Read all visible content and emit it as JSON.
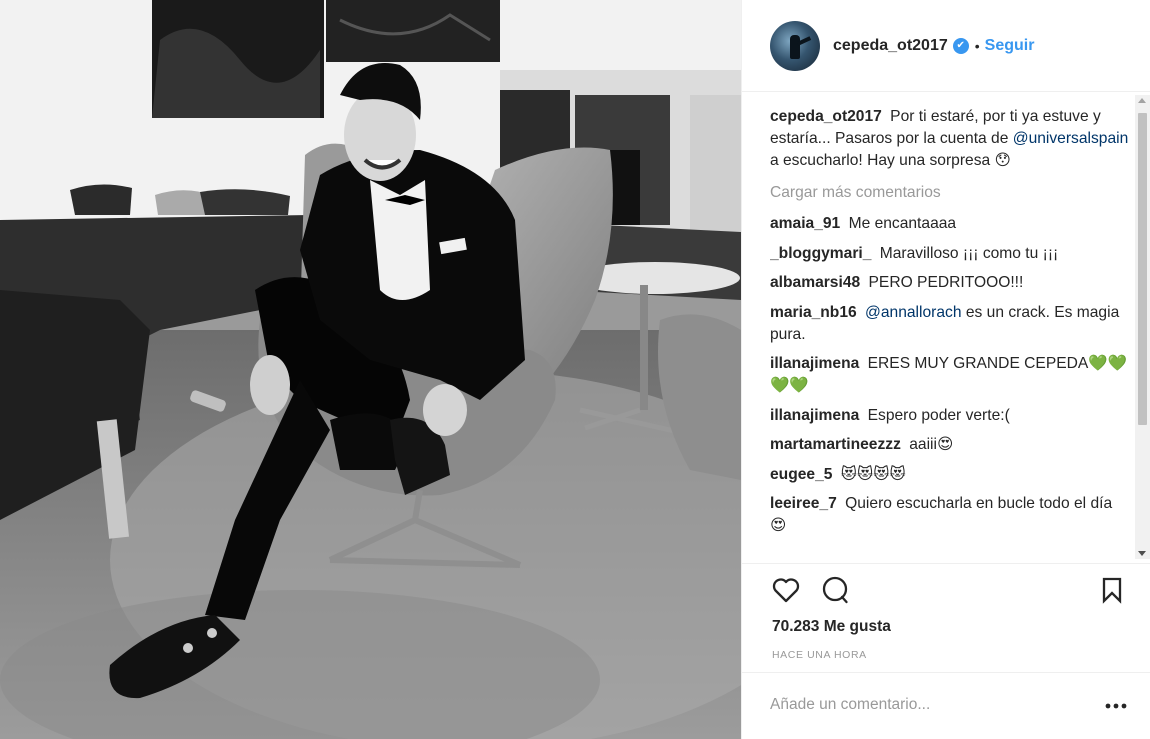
{
  "post": {
    "username": "cepeda_ot2017",
    "verified_mark": "✔",
    "separator": "•",
    "follow_label": "Seguir",
    "caption": {
      "username": "cepeda_ot2017",
      "text_before": "Por ti estaré, por ti ya estuve y estaría... Pasaros por la cuenta de",
      "mention": "@universalspain",
      "text_after": "a escucharlo! Hay una sorpresa",
      "emoji": "😯"
    },
    "load_more_label": "Cargar más comentarios",
    "comments": [
      {
        "username": "amaia_91",
        "text": "Me encantaaaa"
      },
      {
        "username": "_bloggymari_",
        "text": "Maravilloso ¡¡¡ como tu ¡¡¡"
      },
      {
        "username": "albamarsi48",
        "text": "PERO PEDRITOOO!!!"
      },
      {
        "username": "maria_nb16",
        "mention": "@annallorach",
        "text": "es un crack. Es magia pura."
      },
      {
        "username": "illanajimena",
        "text": "ERES MUY GRANDE CEPEDA",
        "emoji": "💚💚💚💚"
      },
      {
        "username": "illanajimena",
        "text": "Espero poder verte:("
      },
      {
        "username": "martamartineezzz",
        "text": "aaiii",
        "emoji": "😍"
      },
      {
        "username": "eugee_5",
        "text": "",
        "emoji": "😻😻😻😻"
      },
      {
        "username": "leeiree_7",
        "text": "Quiero escucharla en bucle todo el día",
        "emoji": "😍"
      }
    ],
    "likes_label": "70.283 Me gusta",
    "time_label": "HACE UNA HORA",
    "add_comment_placeholder": "Añade un comentario...",
    "colors": {
      "accent": "#3897f0",
      "mention": "#003569",
      "muted": "#999999",
      "text": "#262626"
    },
    "icons": [
      "heart-icon",
      "comment-icon",
      "bookmark-icon",
      "more-options-icon",
      "verified-icon"
    ]
  }
}
